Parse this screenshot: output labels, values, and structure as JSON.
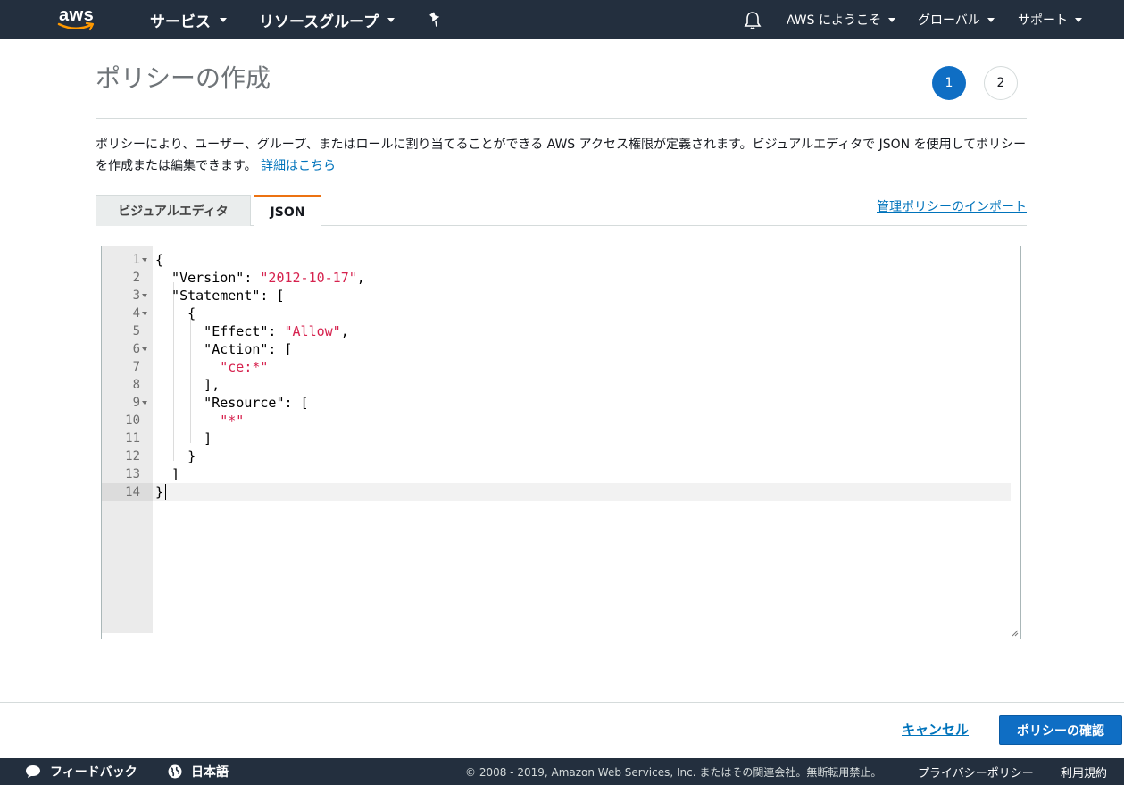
{
  "topnav": {
    "logo_text": "aws",
    "services": "サービス",
    "resource_groups": "リソースグループ",
    "welcome": "AWS にようこそ",
    "region": "グローバル",
    "support": "サポート"
  },
  "page": {
    "title": "ポリシーの作成",
    "steps": [
      "1",
      "2"
    ],
    "description": "ポリシーにより、ユーザー、グループ、またはロールに割り当てることができる AWS アクセス権限が定義されます。ビジュアルエディタで JSON を使用してポリシーを作成または編集できます。",
    "details_link": "詳細はこちら"
  },
  "tabs": {
    "visual_editor": "ビジュアルエディタ",
    "json": "JSON",
    "import_link": "管理ポリシーのインポート"
  },
  "editor": {
    "line_numbers": [
      "1",
      "2",
      "3",
      "4",
      "5",
      "6",
      "7",
      "8",
      "9",
      "10",
      "11",
      "12",
      "13",
      "14"
    ],
    "lines": {
      "l1": "{",
      "l2_key": "  \"Version\": ",
      "l2_val": "\"2012-10-17\"",
      "l2_end": ",",
      "l3": "  \"Statement\": [",
      "l4": "    {",
      "l5_key": "      \"Effect\": ",
      "l5_val": "\"Allow\"",
      "l5_end": ",",
      "l6": "      \"Action\": [",
      "l7_val": "\"ce:*\"",
      "l8": "      ],",
      "l9": "      \"Resource\": [",
      "l10_val": "\"*\"",
      "l11": "      ]",
      "l12": "    }",
      "l13": "  ]",
      "l14": "}"
    }
  },
  "actions": {
    "cancel": "キャンセル",
    "review": "ポリシーの確認"
  },
  "footer": {
    "feedback": "フィードバック",
    "language": "日本語",
    "copyright": "© 2008 - 2019, Amazon Web Services, Inc. またはその関連会社。無断転用禁止。",
    "privacy": "プライバシーポリシー",
    "terms": "利用規約"
  }
}
